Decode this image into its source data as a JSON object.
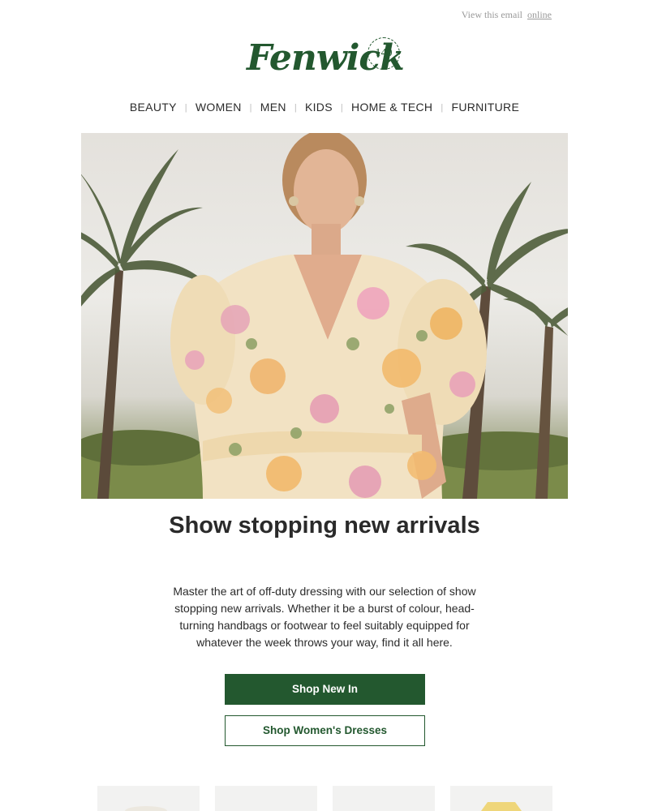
{
  "header": {
    "view_prefix": "View this email",
    "view_link": "online",
    "logo_text": "Fenwick",
    "logo_badge": "140"
  },
  "nav": {
    "items": [
      "BEAUTY",
      "WOMEN",
      "MEN",
      "KIDS",
      "HOME & TECH",
      "FURNITURE"
    ]
  },
  "hero": {
    "image": "woman-in-floral-dress-among-palm-trees"
  },
  "content": {
    "headline": "Show stopping new arrivals",
    "body": "Master the art of off-duty dressing with our selection of show stopping new arrivals. Whether it be a burst of colour, head-turning handbags or footwear to feel suitably equipped for whatever the week throws your way, find it all here."
  },
  "buttons": {
    "primary_label": "Shop New In",
    "secondary_label": "Shop Women's Dresses"
  },
  "colors": {
    "brand_green": "#23582f",
    "text": "#2b2b2b",
    "muted": "#9a9a9a"
  }
}
